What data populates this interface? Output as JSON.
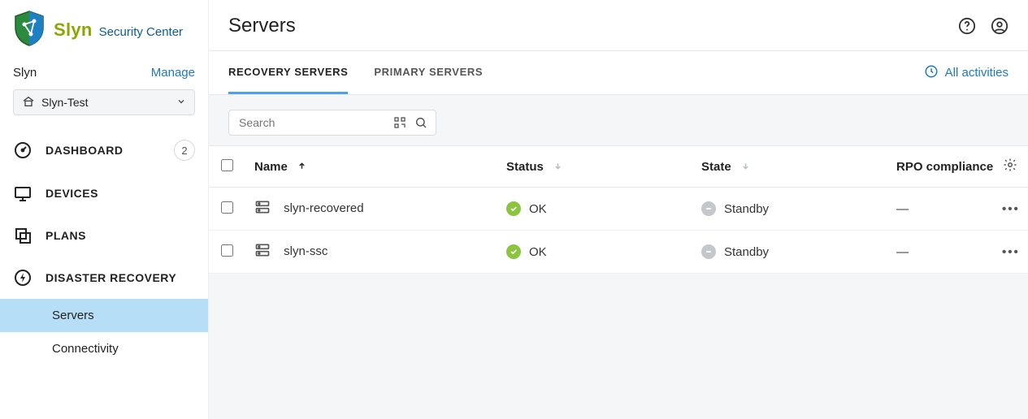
{
  "brand": {
    "name1": "Slyn",
    "name2": "Security Center"
  },
  "tenant": {
    "name": "Slyn",
    "manage": "Manage"
  },
  "picker": {
    "value": "Slyn-Test"
  },
  "nav": {
    "dashboard": {
      "label": "DASHBOARD",
      "badge": "2"
    },
    "devices": {
      "label": "DEVICES"
    },
    "plans": {
      "label": "PLANS"
    },
    "dr": {
      "label": "DISASTER RECOVERY",
      "servers": "Servers",
      "connectivity": "Connectivity"
    }
  },
  "page": {
    "title": "Servers"
  },
  "tabs": {
    "recovery": "RECOVERY SERVERS",
    "primary": "PRIMARY SERVERS"
  },
  "activities": "All activities",
  "search": {
    "placeholder": "Search"
  },
  "columns": {
    "name": "Name",
    "status": "Status",
    "state": "State",
    "rpo": "RPO compliance"
  },
  "status_labels": {
    "ok": "OK"
  },
  "state_labels": {
    "standby": "Standby"
  },
  "rows": [
    {
      "name": "slyn-recovered",
      "status": "OK",
      "state": "Standby",
      "rpo": "—"
    },
    {
      "name": "slyn-ssc",
      "status": "OK",
      "state": "Standby",
      "rpo": "—"
    }
  ]
}
